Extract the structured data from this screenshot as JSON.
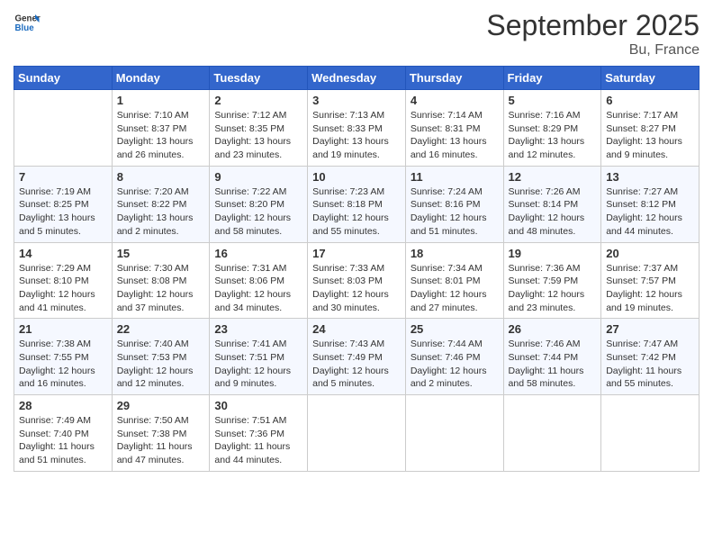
{
  "header": {
    "logo_general": "General",
    "logo_blue": "Blue",
    "title": "September 2025",
    "location": "Bu, France"
  },
  "days_of_week": [
    "Sunday",
    "Monday",
    "Tuesday",
    "Wednesday",
    "Thursday",
    "Friday",
    "Saturday"
  ],
  "weeks": [
    [
      {
        "day": "",
        "info": ""
      },
      {
        "day": "1",
        "info": "Sunrise: 7:10 AM\nSunset: 8:37 PM\nDaylight: 13 hours\nand 26 minutes."
      },
      {
        "day": "2",
        "info": "Sunrise: 7:12 AM\nSunset: 8:35 PM\nDaylight: 13 hours\nand 23 minutes."
      },
      {
        "day": "3",
        "info": "Sunrise: 7:13 AM\nSunset: 8:33 PM\nDaylight: 13 hours\nand 19 minutes."
      },
      {
        "day": "4",
        "info": "Sunrise: 7:14 AM\nSunset: 8:31 PM\nDaylight: 13 hours\nand 16 minutes."
      },
      {
        "day": "5",
        "info": "Sunrise: 7:16 AM\nSunset: 8:29 PM\nDaylight: 13 hours\nand 12 minutes."
      },
      {
        "day": "6",
        "info": "Sunrise: 7:17 AM\nSunset: 8:27 PM\nDaylight: 13 hours\nand 9 minutes."
      }
    ],
    [
      {
        "day": "7",
        "info": "Sunrise: 7:19 AM\nSunset: 8:25 PM\nDaylight: 13 hours\nand 5 minutes."
      },
      {
        "day": "8",
        "info": "Sunrise: 7:20 AM\nSunset: 8:22 PM\nDaylight: 13 hours\nand 2 minutes."
      },
      {
        "day": "9",
        "info": "Sunrise: 7:22 AM\nSunset: 8:20 PM\nDaylight: 12 hours\nand 58 minutes."
      },
      {
        "day": "10",
        "info": "Sunrise: 7:23 AM\nSunset: 8:18 PM\nDaylight: 12 hours\nand 55 minutes."
      },
      {
        "day": "11",
        "info": "Sunrise: 7:24 AM\nSunset: 8:16 PM\nDaylight: 12 hours\nand 51 minutes."
      },
      {
        "day": "12",
        "info": "Sunrise: 7:26 AM\nSunset: 8:14 PM\nDaylight: 12 hours\nand 48 minutes."
      },
      {
        "day": "13",
        "info": "Sunrise: 7:27 AM\nSunset: 8:12 PM\nDaylight: 12 hours\nand 44 minutes."
      }
    ],
    [
      {
        "day": "14",
        "info": "Sunrise: 7:29 AM\nSunset: 8:10 PM\nDaylight: 12 hours\nand 41 minutes."
      },
      {
        "day": "15",
        "info": "Sunrise: 7:30 AM\nSunset: 8:08 PM\nDaylight: 12 hours\nand 37 minutes."
      },
      {
        "day": "16",
        "info": "Sunrise: 7:31 AM\nSunset: 8:06 PM\nDaylight: 12 hours\nand 34 minutes."
      },
      {
        "day": "17",
        "info": "Sunrise: 7:33 AM\nSunset: 8:03 PM\nDaylight: 12 hours\nand 30 minutes."
      },
      {
        "day": "18",
        "info": "Sunrise: 7:34 AM\nSunset: 8:01 PM\nDaylight: 12 hours\nand 27 minutes."
      },
      {
        "day": "19",
        "info": "Sunrise: 7:36 AM\nSunset: 7:59 PM\nDaylight: 12 hours\nand 23 minutes."
      },
      {
        "day": "20",
        "info": "Sunrise: 7:37 AM\nSunset: 7:57 PM\nDaylight: 12 hours\nand 19 minutes."
      }
    ],
    [
      {
        "day": "21",
        "info": "Sunrise: 7:38 AM\nSunset: 7:55 PM\nDaylight: 12 hours\nand 16 minutes."
      },
      {
        "day": "22",
        "info": "Sunrise: 7:40 AM\nSunset: 7:53 PM\nDaylight: 12 hours\nand 12 minutes."
      },
      {
        "day": "23",
        "info": "Sunrise: 7:41 AM\nSunset: 7:51 PM\nDaylight: 12 hours\nand 9 minutes."
      },
      {
        "day": "24",
        "info": "Sunrise: 7:43 AM\nSunset: 7:49 PM\nDaylight: 12 hours\nand 5 minutes."
      },
      {
        "day": "25",
        "info": "Sunrise: 7:44 AM\nSunset: 7:46 PM\nDaylight: 12 hours\nand 2 minutes."
      },
      {
        "day": "26",
        "info": "Sunrise: 7:46 AM\nSunset: 7:44 PM\nDaylight: 11 hours\nand 58 minutes."
      },
      {
        "day": "27",
        "info": "Sunrise: 7:47 AM\nSunset: 7:42 PM\nDaylight: 11 hours\nand 55 minutes."
      }
    ],
    [
      {
        "day": "28",
        "info": "Sunrise: 7:49 AM\nSunset: 7:40 PM\nDaylight: 11 hours\nand 51 minutes."
      },
      {
        "day": "29",
        "info": "Sunrise: 7:50 AM\nSunset: 7:38 PM\nDaylight: 11 hours\nand 47 minutes."
      },
      {
        "day": "30",
        "info": "Sunrise: 7:51 AM\nSunset: 7:36 PM\nDaylight: 11 hours\nand 44 minutes."
      },
      {
        "day": "",
        "info": ""
      },
      {
        "day": "",
        "info": ""
      },
      {
        "day": "",
        "info": ""
      },
      {
        "day": "",
        "info": ""
      }
    ]
  ]
}
